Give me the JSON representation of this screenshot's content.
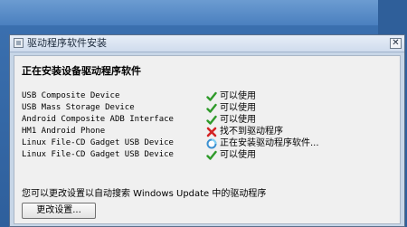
{
  "dialog": {
    "title": "驱动程序软件安装",
    "close_glyph": "✕"
  },
  "content": {
    "heading": "正在安装设备驱动程序软件",
    "devices": [
      {
        "name": "USB Composite Device",
        "status": "可以使用",
        "status_icon": "check-icon"
      },
      {
        "name": "USB Mass Storage Device",
        "status": "可以使用",
        "status_icon": "check-icon"
      },
      {
        "name": "Android Composite ADB Interface",
        "status": "可以使用",
        "status_icon": "check-icon"
      },
      {
        "name": "HM1 Android Phone",
        "status": "找不到驱动程序",
        "status_icon": "error-x-icon"
      },
      {
        "name": "Linux File-CD Gadget USB Device",
        "status": "正在安装驱动程序软件...",
        "status_icon": "busy-icon"
      },
      {
        "name": "Linux File-CD Gadget USB Device",
        "status": "可以使用",
        "status_icon": "check-icon"
      }
    ],
    "info_text": "您可以更改设置以自动搜索 Windows Update 中的驱动程序",
    "change_button_label": "更改设置..."
  },
  "colors": {
    "check": "#2f9a2a",
    "error": "#d42323",
    "busy": "#3a8fd0"
  }
}
